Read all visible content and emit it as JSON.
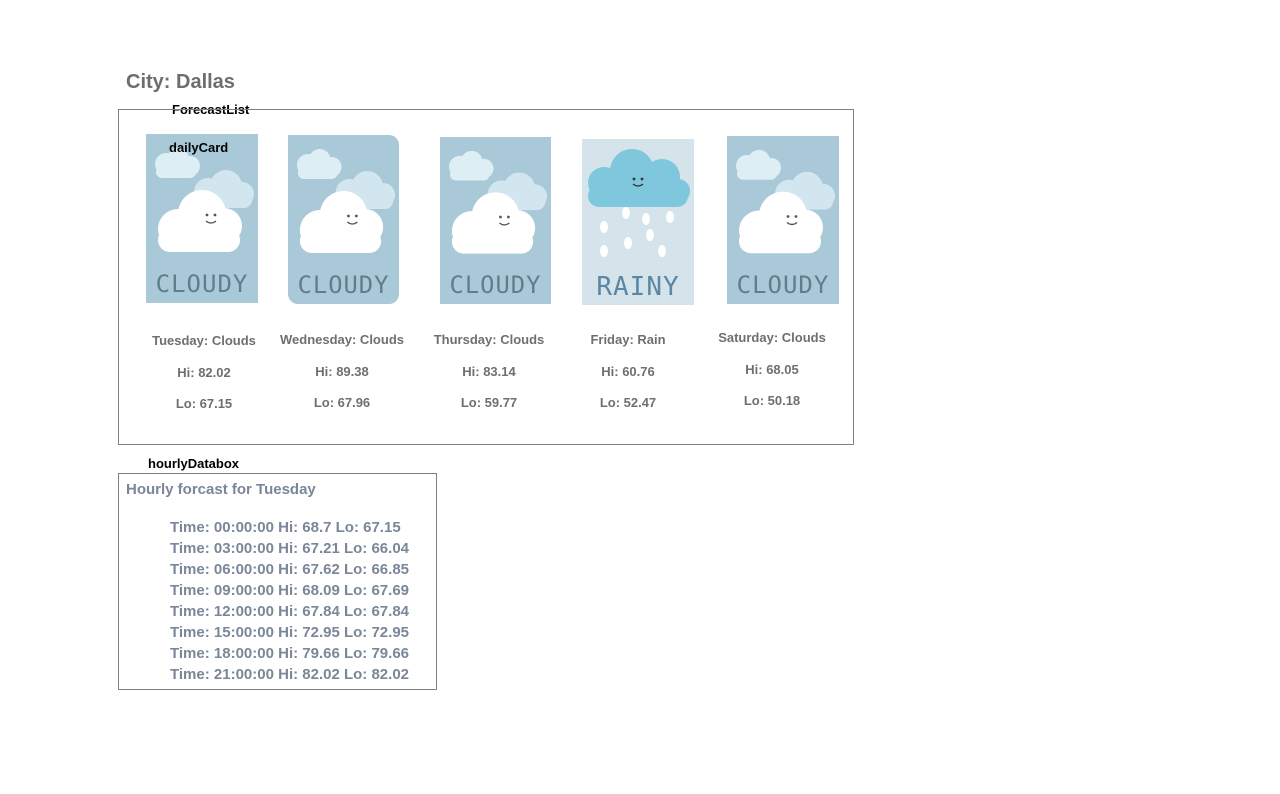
{
  "city": {
    "title": "City: Dallas"
  },
  "labels": {
    "forecast_list": "ForecastList",
    "daily_card": "dailyCard",
    "hourly_databox": "hourlyDatabox"
  },
  "forecast": [
    {
      "icon": "cloudy",
      "image_text": "CLOUDY",
      "day_line": "Tuesday: Clouds",
      "hi": "Hi: 82.02",
      "lo": "Lo: 67.15"
    },
    {
      "icon": "cloudy",
      "image_text": "CLOUDY",
      "day_line": "Wednesday: Clouds",
      "hi": "Hi: 89.38",
      "lo": "Lo: 67.96"
    },
    {
      "icon": "cloudy",
      "image_text": "CLOUDY",
      "day_line": "Thursday: Clouds",
      "hi": "Hi: 83.14",
      "lo": "Lo: 59.77"
    },
    {
      "icon": "rainy",
      "image_text": "RAINY",
      "day_line": "Friday: Rain",
      "hi": "Hi: 60.76",
      "lo": "Lo: 52.47"
    },
    {
      "icon": "cloudy",
      "image_text": "CLOUDY",
      "day_line": "Saturday: Clouds",
      "hi": "Hi: 68.05",
      "lo": "Lo: 50.18"
    }
  ],
  "hourly": {
    "title": "Hourly forcast for Tuesday",
    "rows": [
      "Time: 00:00:00 Hi: 68.7 Lo: 67.15",
      "Time: 03:00:00 Hi: 67.21 Lo: 66.04",
      "Time: 06:00:00 Hi: 67.62 Lo: 66.85",
      "Time: 09:00:00 Hi: 68.09 Lo: 67.69",
      "Time: 12:00:00 Hi: 67.84 Lo: 67.84",
      "Time: 15:00:00 Hi: 72.95 Lo: 72.95",
      "Time: 18:00:00 Hi: 79.66 Lo: 79.66",
      "Time: 21:00:00 Hi: 82.02 Lo: 82.02"
    ]
  },
  "colors": {
    "card_cloudy_bg": "#a9c9d8",
    "card_rainy_bg": "#d5e3ea",
    "rain_cloud": "#7ec7dc",
    "text_gray": "#6f6f6f",
    "hourly_text": "#7a8798",
    "border": "#808080"
  }
}
